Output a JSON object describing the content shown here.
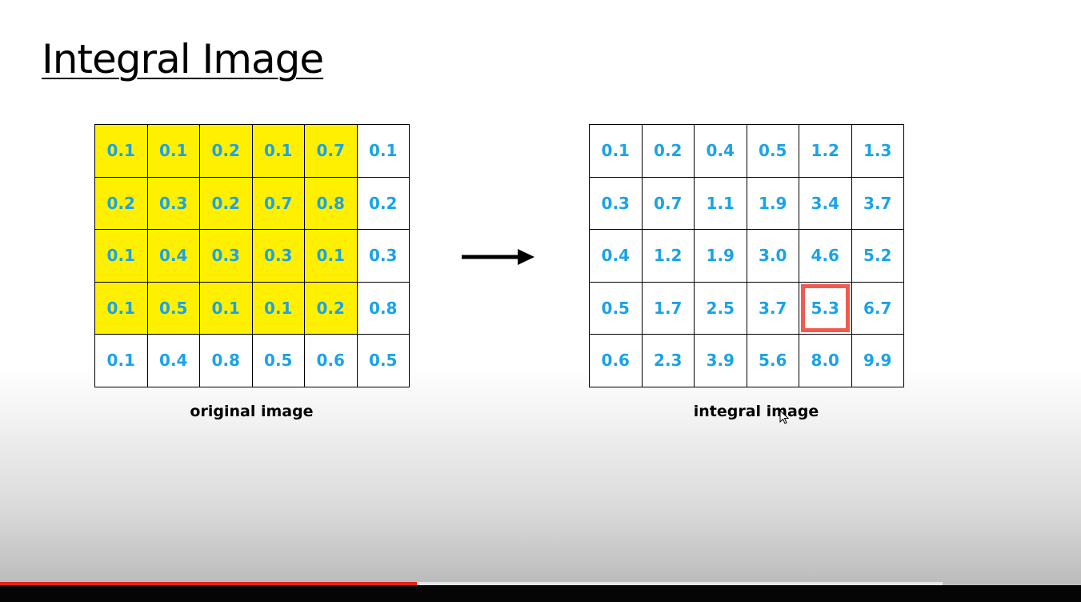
{
  "slide": {
    "title": "Integral Image",
    "original": {
      "caption": "original image",
      "rows": [
        [
          "0.1",
          "0.1",
          "0.2",
          "0.1",
          "0.7",
          "0.1"
        ],
        [
          "0.2",
          "0.3",
          "0.2",
          "0.7",
          "0.8",
          "0.2"
        ],
        [
          "0.1",
          "0.4",
          "0.3",
          "0.3",
          "0.1",
          "0.3"
        ],
        [
          "0.1",
          "0.5",
          "0.1",
          "0.1",
          "0.2",
          "0.8"
        ],
        [
          "0.1",
          "0.4",
          "0.8",
          "0.5",
          "0.6",
          "0.5"
        ]
      ],
      "highlight_rows": 4,
      "highlight_cols": 5,
      "highlight_color": "#ffef00"
    },
    "integral": {
      "caption": "integral image",
      "rows": [
        [
          "0.1",
          "0.2",
          "0.4",
          "0.5",
          "1.2",
          "1.3"
        ],
        [
          "0.3",
          "0.7",
          "1.1",
          "1.9",
          "3.4",
          "3.7"
        ],
        [
          "0.4",
          "1.2",
          "1.9",
          "3.0",
          "4.6",
          "5.2"
        ],
        [
          "0.5",
          "1.7",
          "2.5",
          "3.7",
          "5.3",
          "6.7"
        ],
        [
          "0.6",
          "2.3",
          "3.9",
          "5.6",
          "8.0",
          "9.9"
        ]
      ],
      "boxed_cell": [
        3,
        4
      ],
      "box_color": "#f05a4f"
    },
    "value_color": "#1aa3e8",
    "arrow_icon": "right-arrow-icon"
  },
  "player": {
    "progress_fraction": 0.4426,
    "progress_color": "#e62117",
    "cursor_icon": "mouse-pointer-icon"
  }
}
